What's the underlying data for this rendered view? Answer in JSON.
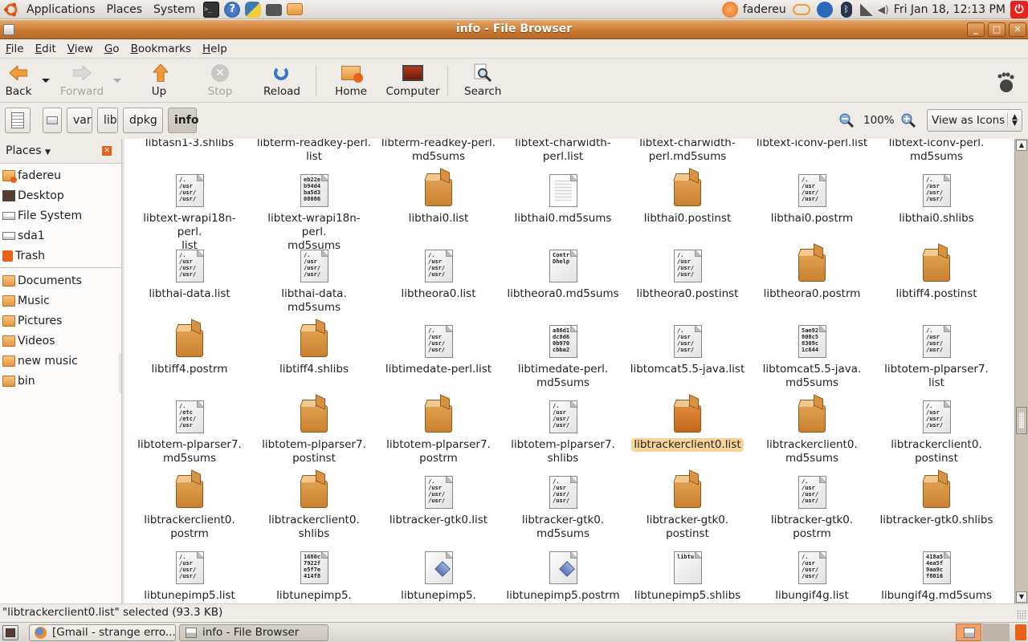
{
  "top_panel": {
    "menus": [
      "Applications",
      "Places",
      "System"
    ],
    "launchers": [
      "terminal-icon",
      "help-icon",
      "python-icon",
      "camera-icon",
      "folder-icon"
    ],
    "user": "fadereu",
    "datetime": "Fri Jan 18, 12:13 PM",
    "tray_icons": [
      "user-switch-icon",
      "update-notifier-icon",
      "network-icon",
      "bluetooth-icon",
      "signal-icon",
      "volume-icon",
      "power-icon"
    ]
  },
  "window": {
    "title": "info - File Browser",
    "controls": [
      "minimize",
      "maximize",
      "close"
    ]
  },
  "menubar": [
    {
      "key": "F",
      "rest": "ile"
    },
    {
      "key": "E",
      "rest": "dit"
    },
    {
      "key": "V",
      "rest": "iew"
    },
    {
      "key": "G",
      "rest": "o"
    },
    {
      "key": "B",
      "rest": "ookmarks"
    },
    {
      "key": "H",
      "rest": "elp"
    }
  ],
  "toolbar": {
    "back": "Back",
    "forward": "Forward",
    "up": "Up",
    "stop": "Stop",
    "reload": "Reload",
    "home": "Home",
    "computer": "Computer",
    "search": "Search"
  },
  "location": {
    "crumbs": [
      "var",
      "lib",
      "dpkg",
      "info"
    ],
    "active_crumb": "info",
    "zoom_level": "100%",
    "view_mode": "View as Icons"
  },
  "sidebar": {
    "header": "Places",
    "places": [
      {
        "label": "fadereu",
        "icon": "home-folder-icon"
      },
      {
        "label": "Desktop",
        "icon": "desktop-icon"
      },
      {
        "label": "File System",
        "icon": "drive-icon"
      },
      {
        "label": "sda1",
        "icon": "drive-icon"
      },
      {
        "label": "Trash",
        "icon": "trash-icon"
      }
    ],
    "bookmarks": [
      {
        "label": "Documents",
        "icon": "folder-icon"
      },
      {
        "label": "Music",
        "icon": "folder-icon"
      },
      {
        "label": "Pictures",
        "icon": "folder-icon"
      },
      {
        "label": "Videos",
        "icon": "folder-icon"
      },
      {
        "label": "new music",
        "icon": "folder-icon"
      },
      {
        "label": "bin",
        "icon": "folder-icon"
      }
    ]
  },
  "files": {
    "partial_top_row": [
      "libtasn1-3.shlibs",
      "libterm-readkey-perl.\nlist",
      "libterm-readkey-perl.\nmd5sums",
      "libtext-charwidth-\nperl.list",
      "libtext-charwidth-\nperl.md5sums",
      "libtext-iconv-perl.list",
      "libtext-iconv-perl.\nmd5sums"
    ],
    "rows": [
      [
        {
          "name": "libtext-wrapi18n-perl.\nlist",
          "type": "text",
          "preview": "/.\n/usr\n/usr/\n/usr/"
        },
        {
          "name": "libtext-wrapi18n-perl.\nmd5sums",
          "type": "text",
          "preview": "eb22e\nb94d4\nba5d3\n08086"
        },
        {
          "name": "libthai0.list",
          "type": "package"
        },
        {
          "name": "libthai0.md5sums",
          "type": "lines"
        },
        {
          "name": "libthai0.postinst",
          "type": "package"
        },
        {
          "name": "libthai0.postrm",
          "type": "text",
          "preview": "/.\n/usr\n/usr/\n/usr/"
        },
        {
          "name": "libthai0.shlibs",
          "type": "text",
          "preview": "/.\n/usr\n/usr/\n/usr/"
        }
      ],
      [
        {
          "name": "libthai-data.list",
          "type": "text",
          "preview": "/.\n/usr\n/usr/\n/usr/"
        },
        {
          "name": "libthai-data.\nmd5sums",
          "type": "text",
          "preview": "/.\n/usr\n/usr/\n/usr/"
        },
        {
          "name": "libtheora0.list",
          "type": "text",
          "preview": "/.\n/usr\n/usr/\n/usr/"
        },
        {
          "name": "libtheora0.md5sums",
          "type": "text",
          "preview": "Contr\nDhelp"
        },
        {
          "name": "libtheora0.postinst",
          "type": "text",
          "preview": "/.\n/usr\n/usr/\n/usr/"
        },
        {
          "name": "libtheora0.postrm",
          "type": "package"
        },
        {
          "name": "libtiff4.postinst",
          "type": "package"
        }
      ],
      [
        {
          "name": "libtiff4.postrm",
          "type": "package"
        },
        {
          "name": "libtiff4.shlibs",
          "type": "package"
        },
        {
          "name": "libtimedate-perl.list",
          "type": "text",
          "preview": "/.\n/usr\n/usr/\n/usr/"
        },
        {
          "name": "libtimedate-perl.\nmd5sums",
          "type": "text",
          "preview": "a86d1\ndc8d6\n0b970\ncbba2"
        },
        {
          "name": "libtomcat5.5-java.list",
          "type": "text",
          "preview": "/.\n/usr\n/usr/\n/usr/"
        },
        {
          "name": "libtomcat5.5-java.\nmd5sums",
          "type": "text",
          "preview": "5ae92\n808c5\n8309c\n1c644"
        },
        {
          "name": "libtotem-plparser7.\nlist",
          "type": "text",
          "preview": "/.\n/usr\n/usr/\n/usr/"
        }
      ],
      [
        {
          "name": "libtotem-plparser7.\nmd5sums",
          "type": "text",
          "preview": "/.\n/etc\n/etc/\n/usr"
        },
        {
          "name": "libtotem-plparser7.\npostinst",
          "type": "package"
        },
        {
          "name": "libtotem-plparser7.\npostrm",
          "type": "package"
        },
        {
          "name": "libtotem-plparser7.\nshlibs",
          "type": "text",
          "preview": "/.\n/usr\n/usr/\n/usr/"
        },
        {
          "name": "libtrackerclient0.list",
          "type": "package",
          "selected": true
        },
        {
          "name": "libtrackerclient0.\nmd5sums",
          "type": "package"
        },
        {
          "name": "libtrackerclient0.\npostinst",
          "type": "text",
          "preview": "/.\n/usr\n/usr/\n/usr/"
        }
      ],
      [
        {
          "name": "libtrackerclient0.\npostrm",
          "type": "package"
        },
        {
          "name": "libtrackerclient0.\nshlibs",
          "type": "package"
        },
        {
          "name": "libtracker-gtk0.list",
          "type": "text",
          "preview": "/.\n/usr\n/usr/\n/usr/"
        },
        {
          "name": "libtracker-gtk0.\nmd5sums",
          "type": "text",
          "preview": "/.\n/usr\n/usr/\n/usr/"
        },
        {
          "name": "libtracker-gtk0.\npostinst",
          "type": "package"
        },
        {
          "name": "libtracker-gtk0.\npostrm",
          "type": "text",
          "preview": "/.\n/usr\n/usr/\n/usr/"
        },
        {
          "name": "libtracker-gtk0.shlibs",
          "type": "package"
        }
      ],
      [
        {
          "name": "libtunepimp5.list",
          "type": "text",
          "preview": "/.\n/usr\n/usr/\n/usr/"
        },
        {
          "name": "libtunepimp5.",
          "type": "text",
          "preview": "1680c\n7922f\ne5f7e\n414f8"
        },
        {
          "name": "libtunepimp5.",
          "type": "script"
        },
        {
          "name": "libtunepimp5.postrm",
          "type": "script"
        },
        {
          "name": "libtunepimp5.shlibs",
          "type": "text",
          "preview": "libtu"
        },
        {
          "name": "libungif4g.list",
          "type": "text",
          "preview": "/.\n/usr\n/usr/\n/usr/"
        },
        {
          "name": "libungif4g.md5sums",
          "type": "text",
          "preview": "418a5\n4ea5f\n9aa9c\nf8016"
        }
      ]
    ]
  },
  "scrollbar": {
    "position_fraction": 0.62
  },
  "status": "\"libtrackerclient0.list\" selected (93.3 KB)",
  "taskbar": {
    "tasks": [
      {
        "label": "[Gmail - strange erro...",
        "icon": "firefox-icon",
        "active": false
      },
      {
        "label": "info - File Browser",
        "icon": "file-browser-icon",
        "active": true
      }
    ]
  },
  "colors": {
    "accent_orange": "#c8782f",
    "selection": "#f9d497",
    "panel_bg": "#efebe7"
  }
}
